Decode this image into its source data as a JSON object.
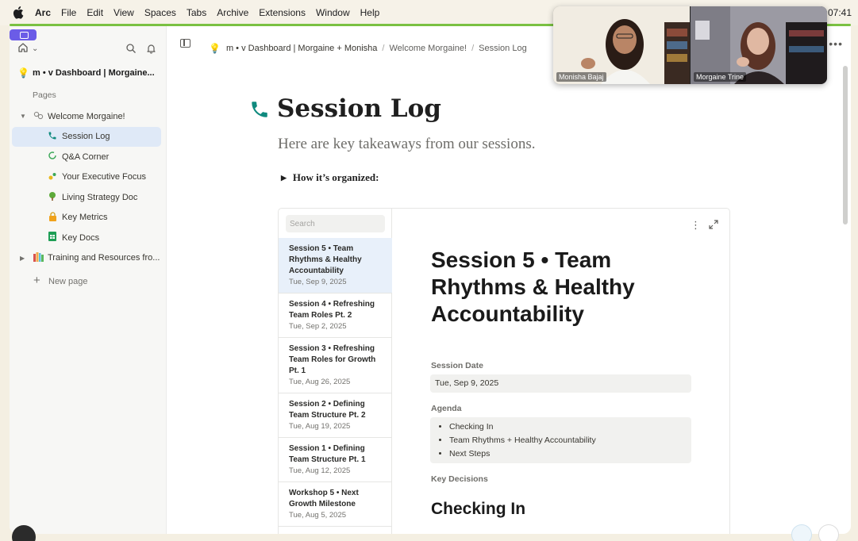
{
  "menubar": {
    "app": "Arc",
    "items": [
      "File",
      "Edit",
      "View",
      "Spaces",
      "Tabs",
      "Archive",
      "Extensions",
      "Window",
      "Help"
    ],
    "clock": "07:41"
  },
  "sidebar": {
    "workspace_name": "m • v Dashboard | Morgaine...",
    "pages_label": "Pages",
    "items": [
      {
        "label": "Welcome Morgaine!",
        "icon": "link-chain-icon"
      },
      {
        "label": "Session Log",
        "icon": "phone-icon"
      },
      {
        "label": "Q&A Corner",
        "icon": "circle-arrow-icon"
      },
      {
        "label": "Your Executive Focus",
        "icon": "sparkle-icon"
      },
      {
        "label": "Living Strategy Doc",
        "icon": "tree-icon"
      },
      {
        "label": "Key Metrics",
        "icon": "lock-icon"
      },
      {
        "label": "Key Docs",
        "icon": "spreadsheet-icon"
      },
      {
        "label": "Training and Resources fro...",
        "icon": "books-icon"
      }
    ],
    "new_page": "New page"
  },
  "topbar": {
    "crumb1": "m • v Dashboard | Morgaine + Monisha",
    "crumb2": "Welcome Morgaine!",
    "crumb3": "Session Log"
  },
  "page": {
    "title": "Session Log",
    "subtitle": "Here are key takeaways from our sessions.",
    "toggle": "How it’s organized:"
  },
  "database": {
    "search_placeholder": "Search",
    "sessions": [
      {
        "title": "Session 5 • Team Rhythms & Healthy Accountability",
        "date": "Tue, Sep 9, 2025"
      },
      {
        "title": "Session 4 • Refreshing Team Roles Pt. 2",
        "date": "Tue, Sep 2, 2025"
      },
      {
        "title": "Session 3 • Refreshing Team Roles for Growth Pt. 1",
        "date": "Tue, Aug 26, 2025"
      },
      {
        "title": "Session 2 • Defining Team Structure Pt. 2",
        "date": "Tue, Aug 19, 2025"
      },
      {
        "title": "Session 1 • Defining Team Structure Pt. 1",
        "date": "Tue, Aug 12, 2025"
      },
      {
        "title": "Workshop 5 • Next Growth Milestone",
        "date": "Tue, Aug 5, 2025"
      }
    ],
    "detail": {
      "title": "Session 5 • Team Rhythms & Healthy Accountability",
      "date_label": "Session Date",
      "date_value": "Tue, Sep 9, 2025",
      "agenda_label": "Agenda",
      "agenda": [
        "Checking In",
        "Team Rhythms + Healthy Accountability",
        "Next Steps"
      ],
      "decisions_label": "Key Decisions",
      "heading": "Checking In"
    }
  },
  "video": {
    "participant1": "Monisha Bajaj",
    "participant2": "Morgaine Trine"
  },
  "colors": {
    "accent_green": "#7ac142",
    "spaces_purple": "#6b5ce7",
    "selected_bg": "#dfe9f7",
    "phone_teal": "#0f8a7e"
  }
}
